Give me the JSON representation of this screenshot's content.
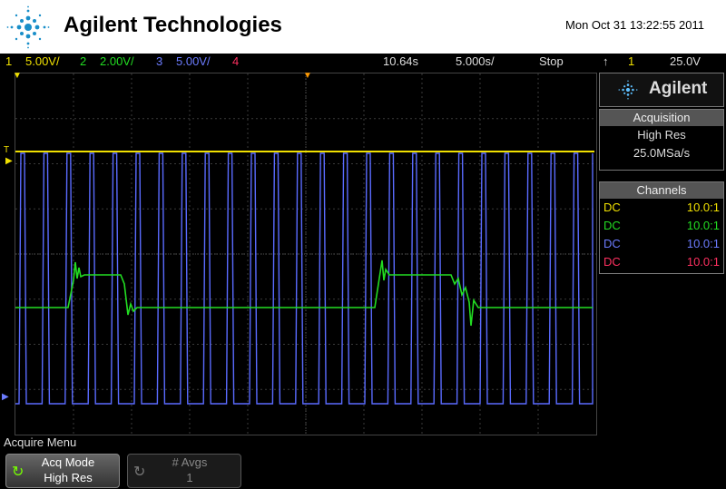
{
  "header": {
    "brand": "Agilent Technologies",
    "datetime": "Mon Oct 31 13:22:55 2011"
  },
  "status": {
    "ch1_num": "1",
    "ch1_scale": "5.00V/",
    "ch2_num": "2",
    "ch2_scale": "2.00V/",
    "ch3_num": "3",
    "ch3_scale": "5.00V/",
    "ch4_num": "4",
    "time_pos": "10.64s",
    "time_scale": "5.000s/",
    "run_state": "Stop",
    "trig_source": "1",
    "trig_level": "25.0V"
  },
  "side": {
    "logo": "Agilent",
    "acquisition": {
      "title": "Acquisition",
      "mode": "High Res",
      "rate": "25.0MSa/s"
    },
    "channels": {
      "title": "Channels",
      "rows": [
        {
          "coupling": "DC",
          "probe": "10.0:1"
        },
        {
          "coupling": "DC",
          "probe": "10.0:1"
        },
        {
          "coupling": "DC",
          "probe": "10.0:1"
        },
        {
          "coupling": "DC",
          "probe": "10.0:1"
        }
      ]
    }
  },
  "menu": {
    "title": "Acquire Menu",
    "acq_mode_label": "Acq Mode",
    "acq_mode_value": "High Res",
    "avgs_label": "# Avgs",
    "avgs_value": "1"
  },
  "markers": {
    "trig_level_marker": "T"
  },
  "colors": {
    "ch1": "#f0e000",
    "ch2": "#22dd22",
    "ch3": "#6c7cff",
    "ch4": "#ff3060"
  }
}
